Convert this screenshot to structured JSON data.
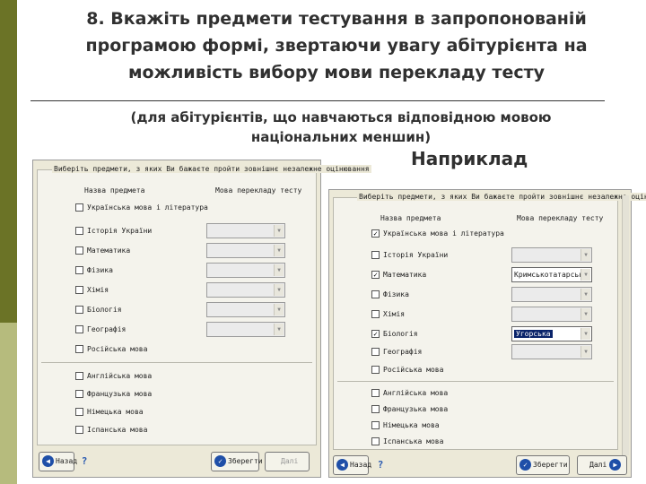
{
  "title_lines": [
    "8. Вкажіть предмети тестування в запропонованій",
    "програмою формі, звертаючи увагу абітурієнта на",
    "можливість вибору мови перекладу тесту"
  ],
  "subtitle_lines": [
    "(для абітурієнтів, що навчаються відповідною мовою",
    "національних меншин)"
  ],
  "example_label": "Наприклад",
  "dialog_left": {
    "group_title": "Виберіть предмети, з яких Ви бажаєте пройти зовнішнє незалежне оцінювання",
    "col_subject": "Назва предмета",
    "col_language": "Мова перекладу тесту",
    "subjects": [
      {
        "label": "Українська мова і література",
        "checked": false
      },
      {
        "label": "Історія України",
        "checked": false
      },
      {
        "label": "Математика",
        "checked": false
      },
      {
        "label": "Фізика",
        "checked": false
      },
      {
        "label": "Хімія",
        "checked": false
      },
      {
        "label": "Біологія",
        "checked": false
      },
      {
        "label": "Географія",
        "checked": false
      },
      {
        "label": "Російська мова",
        "checked": false
      },
      {
        "label": "Англійська мова",
        "checked": false
      },
      {
        "label": "Французька мова",
        "checked": false
      },
      {
        "label": "Німецька мова",
        "checked": false
      },
      {
        "label": "Іспанська мова",
        "checked": false
      }
    ],
    "back_label": "Назад",
    "help_label": "?",
    "save_label": "Зберегти",
    "next_label": "Далі"
  },
  "dialog_right": {
    "group_title": "Виберіть предмети, з яких Ви бажаєте пройти зовнішнє незалежне оцінювання",
    "col_subject": "Назва предмета",
    "col_language": "Мова перекладу тесту",
    "subjects": [
      {
        "label": "Українська мова і література",
        "checked": true
      },
      {
        "label": "Історія України",
        "checked": false
      },
      {
        "label": "Математика",
        "checked": true,
        "language": "Кримськотатарська"
      },
      {
        "label": "Фізика",
        "checked": false
      },
      {
        "label": "Хімія",
        "checked": false
      },
      {
        "label": "Біологія",
        "checked": true,
        "language": "Угорська"
      },
      {
        "label": "Географія",
        "checked": false
      },
      {
        "label": "Російська мова",
        "checked": false
      },
      {
        "label": "Англійська мова",
        "checked": false
      },
      {
        "label": "Французька мова",
        "checked": false
      },
      {
        "label": "Німецька мова",
        "checked": false
      },
      {
        "label": "Іспанська мова",
        "checked": false
      }
    ],
    "back_label": "Назад",
    "help_label": "?",
    "save_label": "Зберегти",
    "next_label": "Далі"
  },
  "colors": {
    "accent_dark": "#6b7326",
    "accent_light": "#b6bb7d",
    "dialog_bg": "#ece9d8",
    "selection": "#0a246a"
  }
}
